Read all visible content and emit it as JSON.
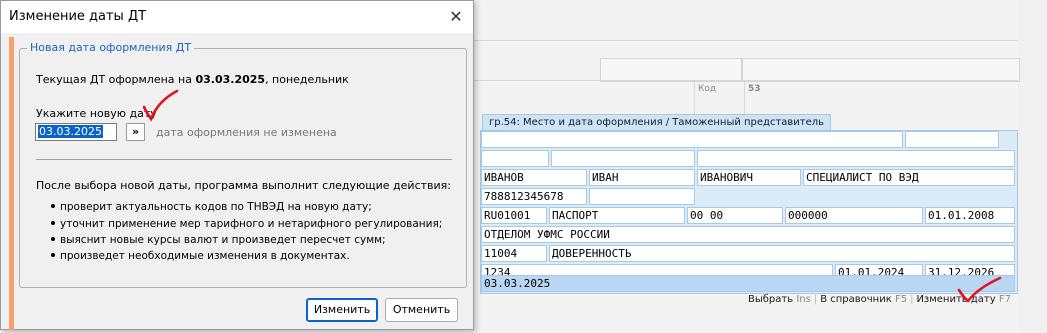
{
  "dialog": {
    "title": "Изменение даты ДТ",
    "close_glyph": "✕",
    "group_legend": "Новая дата оформления ДТ",
    "current_prefix": "Текущая ДТ оформлена на ",
    "current_date": "03.03.2025",
    "current_suffix": ", понедельник",
    "new_date_label": "Укажите новую дату",
    "new_date_value": "03.03.2025",
    "arrow_glyph": "»",
    "unchanged_note": "дата оформления не изменена",
    "after_label": "После выбора новой даты, программа выполнит следующие действия:",
    "actions": [
      "проверит актуальность кодов по ТНВЭД на новую дату;",
      "уточнит применение мер тарифного и нетарифного регулирования;",
      "выяснит новые курсы валют и произведет пересчет сумм;",
      "произведет необходимые изменения в документах."
    ],
    "ok_label": "Изменить",
    "cancel_label": "Отменить"
  },
  "form": {
    "code_label": "Код",
    "code_value": "53",
    "group54_title": "гр.54: Место и дата оформления / Таможенный представитель",
    "rows": {
      "last_name": "ИВАНОВ",
      "first_name": "ИВАН",
      "patronymic": "ИВАНОВИЧ",
      "position": "СПЕЦИАЛИСТ ПО ВЭД",
      "phone": "788812345678",
      "doc_code": "RU01001",
      "doc_name": "ПАСПОРТ",
      "doc_series": "00 00",
      "doc_number": "000000",
      "doc_date": "01.01.2008",
      "issued_by": "ОТДЕЛОМ УФМС РОССИИ",
      "auth_code": "11004",
      "auth_name": "ДОВЕРЕННОСТЬ",
      "auth_number": "1234",
      "auth_from": "01.01.2024",
      "auth_to": "31.12.2026",
      "decl_date": "03.03.2025"
    }
  },
  "statusbar": {
    "select_label": "Выбрать",
    "select_key": "Ins",
    "ref_label": "В справочник",
    "ref_key": "F5",
    "change_label": "Изменить дату",
    "change_key": "F7"
  },
  "colors": {
    "accent": "#0a63c9",
    "check_mark": "#e0141e",
    "orange_bar": "#f4a26a",
    "grid_border": "#a6c9e8",
    "highlight_row": "#b9d7f3"
  }
}
